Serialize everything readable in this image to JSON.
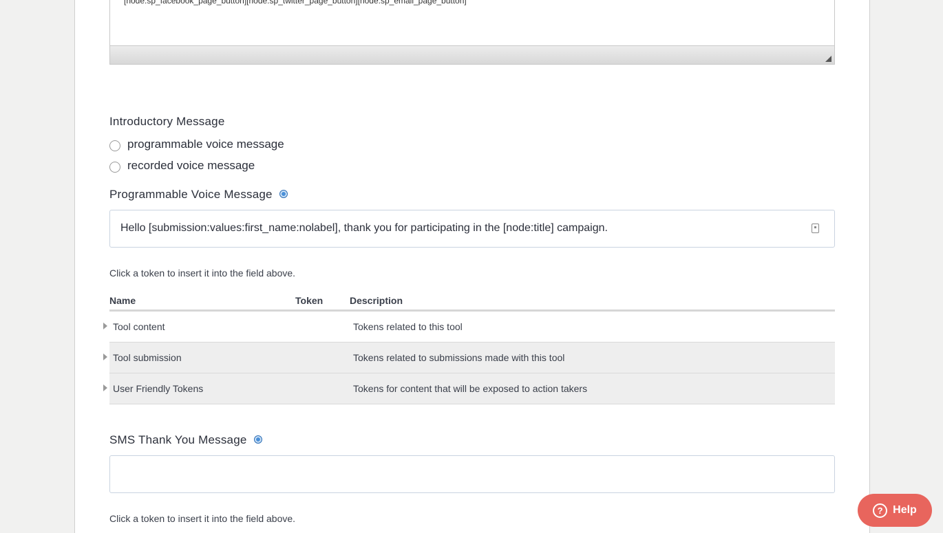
{
  "top_editor": {
    "content": "[node:sp_facebook_page_button][node:sp_twitter_page_button][node:sp_email_page_button]"
  },
  "intro": {
    "label": "Introductory Message",
    "options": [
      "programmable voice message",
      "recorded voice message"
    ]
  },
  "voice": {
    "label": "Programmable Voice Message",
    "value": "Hello [submission:values:first_name:nolabel], thank you for participating in the [node:title] campaign.",
    "hint": "Click a token to insert it into the field above."
  },
  "token_table": {
    "headers": [
      "Name",
      "Token",
      "Description"
    ],
    "rows": [
      {
        "name": "Tool content",
        "description": "Tokens related to this tool"
      },
      {
        "name": "Tool submission",
        "description": "Tokens related to submissions made with this tool"
      },
      {
        "name": "User Friendly Tokens",
        "description": "Tokens for content that will be exposed to action takers"
      }
    ]
  },
  "sms": {
    "label": "SMS Thank You Message",
    "value": "",
    "hint": "Click a token to insert it into the field above."
  },
  "help": {
    "label": "Help",
    "color": "#e8655d"
  }
}
